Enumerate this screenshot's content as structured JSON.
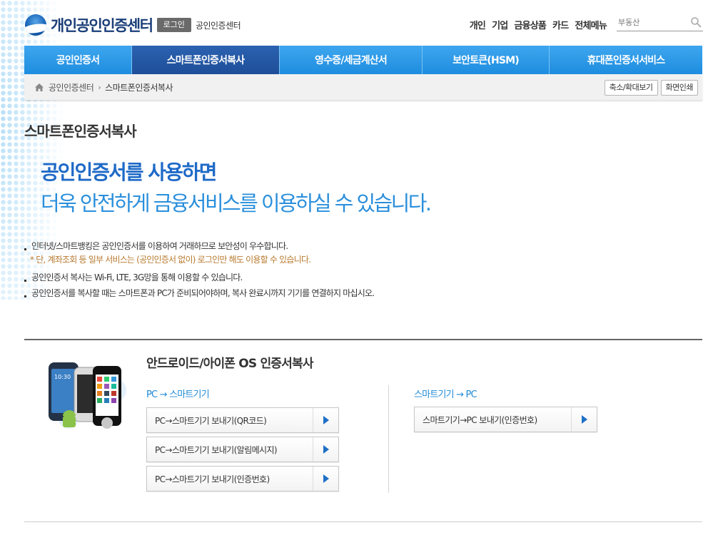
{
  "header": {
    "logo_text": "개인공인인증센터",
    "login_label": "로그인",
    "center_name": "공인인증센터",
    "util_nav": [
      "개인",
      "기업",
      "금융상품",
      "카드",
      "전체메뉴"
    ],
    "search_placeholder": "부동산"
  },
  "gnb": {
    "items": [
      "공인인증서",
      "스마트폰인증서복사",
      "영수증/세금계산서",
      "보안토큰(HSM)",
      "휴대폰인증서서비스"
    ],
    "active_index": 1
  },
  "breadcrumb": {
    "items": [
      "공인인증센터",
      "스마트폰인증서복사"
    ],
    "tools": [
      "축소/확대보기",
      "화면인쇄"
    ]
  },
  "content": {
    "page_title": "스마트폰인증서복사",
    "hero_line1": "공인인증서를 사용하면",
    "hero_line2": "더욱 안전하게 금융서비스를 이용하실 수 있습니다.",
    "notes": [
      "인터넷/스마트뱅킹은 공인인증서를 이용하여 거래하므로 보안성이 우수합니다.",
      "* 단, 계좌조회 등 일부 서비스는 (공인인증서 없이) 로그인만 해도 이용할 수 있습니다.",
      "공인인증서 복사는 Wi-Fi, LTE, 3G망을 통해 이용할 수 있습니다.",
      "공인인증서를 복사할 때는 스마트폰과 PC가 준비되어야하며, 복사 완료시까지 기기를 연결하지 마십시오."
    ]
  },
  "copy_section": {
    "title": "안드로이드/아이폰 OS 인증서복사",
    "phone_time": "10:30",
    "left_head": "PC → 스마트기기",
    "left_buttons": [
      "PC→스마트기기 보내기(QR코드)",
      "PC→스마트기기 보내기(알림메시지)",
      "PC→스마트기기 보내기(인증번호)"
    ],
    "right_head": "스마트기기 → PC",
    "right_buttons": [
      "스마트기기→PC 보내기(인증번호)"
    ]
  },
  "colors": {
    "gnb_blue": "#2a96e6",
    "gnb_active": "#2559a6",
    "hero_dark_blue": "#1f6ac7",
    "hero_light_blue": "#2a8fdc",
    "note_sub": "#b87a2f",
    "arrow_blue": "#1e6fc6"
  }
}
